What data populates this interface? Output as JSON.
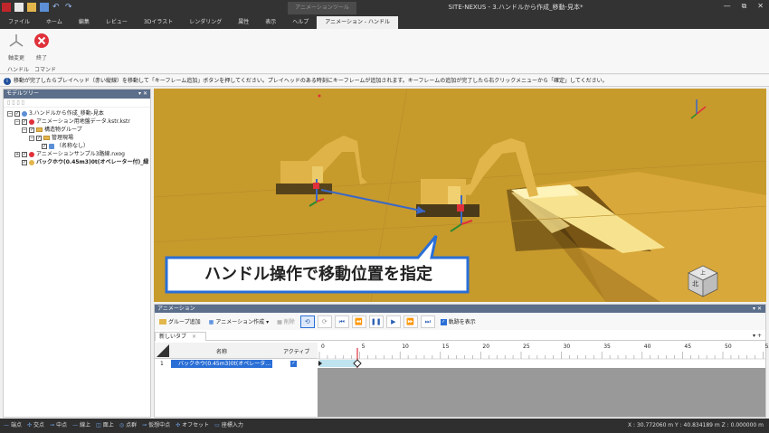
{
  "window": {
    "title": "SITE-NEXUS - 3.ハンドルから作成_移動-見本*",
    "contextual_group": "アニメーションツール",
    "controls": [
      "—",
      "⧉",
      "✕"
    ]
  },
  "ribbon_tabs": [
    {
      "label": "ファイル"
    },
    {
      "label": "ホーム"
    },
    {
      "label": "編集"
    },
    {
      "label": "レビュー"
    },
    {
      "label": "3Dイラスト"
    },
    {
      "label": "レンダリング"
    },
    {
      "label": "属性"
    },
    {
      "label": "表示"
    },
    {
      "label": "ヘルプ"
    },
    {
      "label": "アニメーション - ハンドル",
      "active": true
    }
  ],
  "ribbon": {
    "btn_adjust": "軸変更",
    "btn_end": "終了",
    "group_handle": "ハンドル",
    "group_command": "コマンド"
  },
  "info_message": "移動が完了したらプレイヘッド（赤い縦線）を移動して「キーフレーム追加」ボタンを押してください。プレイヘッドのある時刻にキーフレームが追加されます。キーフレームの追加が完了したら右クリックメニューから「確定」してください。",
  "tree": {
    "title": "モデルツリー",
    "header_controls": "▾ ✕",
    "tools": "▯ ▯ ▯ ▯",
    "nodes": [
      {
        "label": "3.ハンドルから作成_移動-見本"
      },
      {
        "label": "アニメーション用地盤データ.kstr.kstr"
      },
      {
        "label": "構造物グループ"
      },
      {
        "label": "管理現場"
      },
      {
        "label": "（名称なし）"
      },
      {
        "label": "アニメーションサンプル3路線.nxog"
      },
      {
        "label": "バックホウ(0.45m3)0t(オペレーター付)_緑"
      }
    ]
  },
  "viewport": {
    "banner_text": "ハンドル操作で移動位置を指定",
    "navcube_top": "上",
    "navcube_front": "北"
  },
  "colors": {
    "ground": "#c79a2c",
    "banner_border": "#2a6fd6",
    "panel_header": "#5b6e8a"
  },
  "animation": {
    "title": "アニメーション",
    "header_controls": "▾ ✕",
    "toolbar": {
      "group_add": "グループ追加",
      "create": "アニメーション作成",
      "delete": "削除",
      "show_path": "軌跡を表示"
    },
    "tab_label": "新しいタブ",
    "tab_close": "×",
    "tab_right": "▾ +",
    "grid": {
      "col_name": "名称",
      "col_active": "アクティブ",
      "rows": [
        {
          "index": "1",
          "name": "バックホウ(0.45m3)0t(オペレータ…",
          "active": "✓"
        }
      ]
    },
    "ruler_ticks": [
      "0",
      "5",
      "10",
      "15",
      "20",
      "25",
      "30",
      "35",
      "40",
      "45",
      "50",
      "55"
    ]
  },
  "status": {
    "snaps": [
      {
        "icon": "—",
        "label": "端点"
      },
      {
        "icon": "✣",
        "label": "交点"
      },
      {
        "icon": "⊸",
        "label": "中点"
      },
      {
        "icon": "—",
        "label": "線上"
      },
      {
        "icon": "◫",
        "label": "面上"
      },
      {
        "icon": "◎",
        "label": "点群"
      },
      {
        "icon": "⊸",
        "label": "仮想中点"
      },
      {
        "icon": "✣",
        "label": "オフセット"
      },
      {
        "icon": "▭",
        "label": "座標入力"
      }
    ],
    "coords": "X : 30.772060 m    Y : 40.834189 m    Z : 0.000000 m"
  }
}
